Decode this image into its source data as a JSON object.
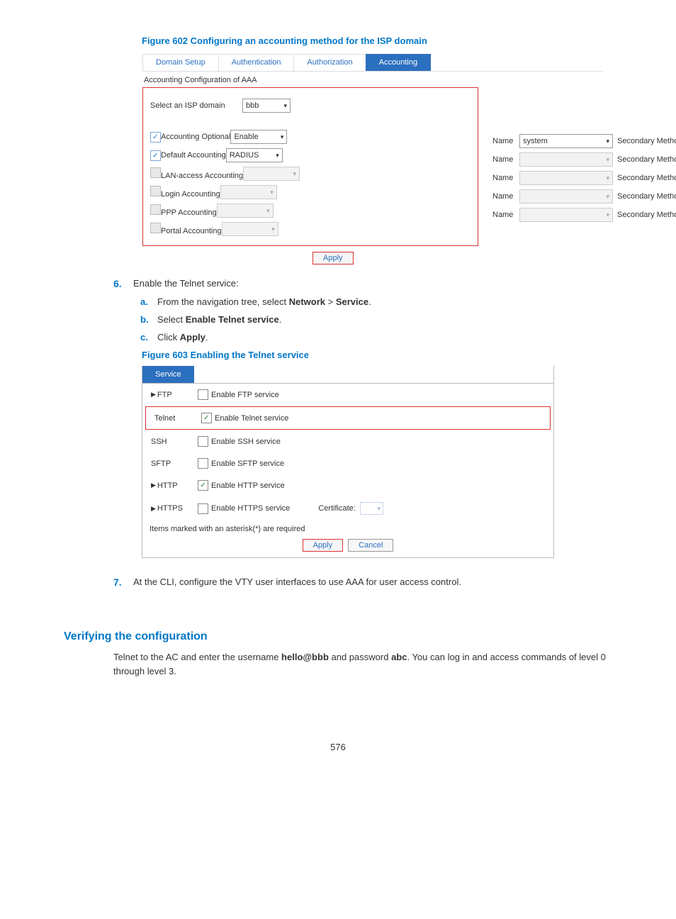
{
  "fig602": {
    "title": "Figure 602 Configuring an accounting method for the ISP domain",
    "tabs": [
      "Domain Setup",
      "Authentication",
      "Authorization",
      "Accounting"
    ],
    "subtitle": "Accounting Configuration of AAA",
    "domain_label": "Select an ISP domain",
    "domain_value": "bbb",
    "rows": [
      {
        "checked": true,
        "enabled": true,
        "label": "Accounting Optional",
        "val": "Enable",
        "hasName": false,
        "nameVal": "",
        "hasSecondary": false
      },
      {
        "checked": true,
        "enabled": true,
        "label": "Default Accounting",
        "val": "RADIUS",
        "hasName": true,
        "nameVal": "system",
        "hasSecondary": true
      },
      {
        "checked": false,
        "enabled": false,
        "label": "LAN-access Accounting",
        "val": "",
        "hasName": true,
        "nameVal": "",
        "hasSecondary": true
      },
      {
        "checked": false,
        "enabled": false,
        "label": "Login Accounting",
        "val": "",
        "hasName": true,
        "nameVal": "",
        "hasSecondary": true
      },
      {
        "checked": false,
        "enabled": false,
        "label": "PPP Accounting",
        "val": "",
        "hasName": true,
        "nameVal": "",
        "hasSecondary": true
      },
      {
        "checked": false,
        "enabled": false,
        "label": "Portal Accounting",
        "val": "",
        "hasName": true,
        "nameVal": "",
        "hasSecondary": true
      }
    ],
    "name_label": "Name",
    "secondary_label": "Secondary Method",
    "apply": "Apply"
  },
  "step6": {
    "num": "6.",
    "text": "Enable the Telnet service:",
    "a": {
      "let": "a.",
      "pre": "From the navigation tree, select ",
      "b1": "Network",
      "gt": " > ",
      "b2": "Service",
      "post": "."
    },
    "b": {
      "let": "b.",
      "pre": "Select ",
      "b1": "Enable Telnet service",
      "post": "."
    },
    "c": {
      "let": "c.",
      "pre": "Click ",
      "b1": "Apply",
      "post": "."
    }
  },
  "fig603": {
    "title": "Figure 603 Enabling the Telnet service",
    "tab": "Service",
    "rows": [
      {
        "arrow": true,
        "name": "FTP",
        "checked": false,
        "label": "Enable FTP service",
        "red": false,
        "cert": false
      },
      {
        "arrow": false,
        "name": "Telnet",
        "checked": true,
        "label": "Enable Telnet service",
        "red": true,
        "cert": false
      },
      {
        "arrow": false,
        "name": "SSH",
        "checked": false,
        "label": "Enable SSH service",
        "red": false,
        "cert": false
      },
      {
        "arrow": false,
        "name": "SFTP",
        "checked": false,
        "label": "Enable SFTP service",
        "red": false,
        "cert": false
      },
      {
        "arrow": true,
        "name": "HTTP",
        "checked": true,
        "label": "Enable HTTP service",
        "red": false,
        "cert": false
      },
      {
        "arrow": true,
        "name": "HTTPS",
        "checked": false,
        "label": "Enable HTTPS service",
        "red": false,
        "cert": true
      }
    ],
    "cert_label": "Certificate:",
    "note": "Items marked with an asterisk(*) are required",
    "apply": "Apply",
    "cancel": "Cancel"
  },
  "step7": {
    "num": "7.",
    "text": "At the CLI, configure the VTY user interfaces to use AAA for user access control."
  },
  "verify": {
    "heading": "Verifying the configuration",
    "t1": "Telnet to the AC and enter the username ",
    "b1": "hello@bbb",
    "t2": " and password ",
    "b2": "abc",
    "t3": ". You can log in and access commands of level 0 through level 3."
  },
  "page": "576"
}
